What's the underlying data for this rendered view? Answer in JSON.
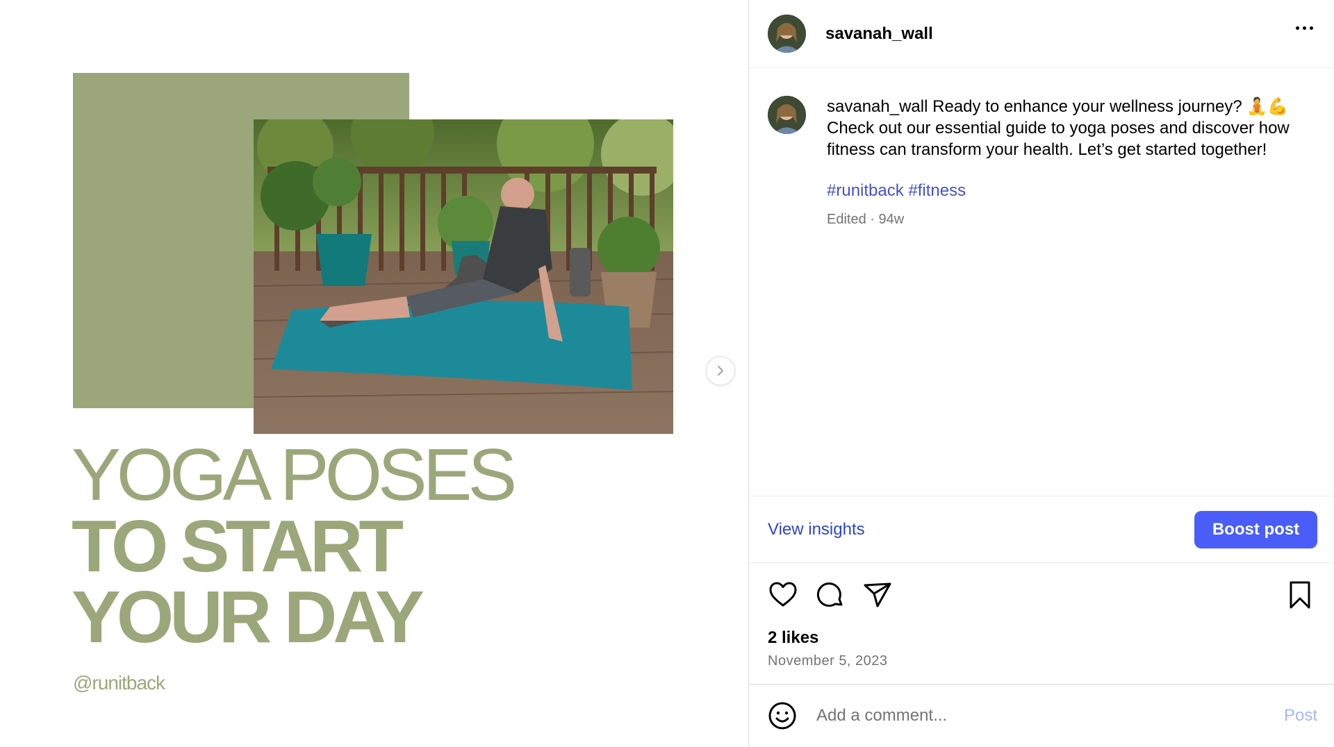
{
  "media": {
    "headline_line1": "YOGA POSES",
    "headline_line2": "TO START",
    "headline_line3": "YOUR DAY",
    "handle": "@runitback",
    "accent_color": "#9ba77a",
    "next_icon": "chevron-right-icon"
  },
  "header": {
    "username": "savanah_wall",
    "more_icon": "more-horizontal-icon"
  },
  "caption": {
    "username": "savanah_wall",
    "text": "Ready to enhance your wellness journey? 🧘💪 Check out our essential guide to yoga poses and discover how fitness can transform your health. Let’s get started together!",
    "hashtags": [
      "#runitback",
      "#fitness"
    ],
    "meta": "Edited · 94w"
  },
  "insights": {
    "view_label": "View insights",
    "boost_label": "Boost post",
    "boost_color": "#4a5df9"
  },
  "actions": {
    "icons": [
      "heart-icon",
      "comment-icon",
      "share-icon",
      "bookmark-icon"
    ],
    "likes": "2 likes",
    "date": "November 5, 2023"
  },
  "comment": {
    "placeholder": "Add a comment...",
    "post_label": "Post",
    "emoji_icon": "emoji-icon"
  }
}
